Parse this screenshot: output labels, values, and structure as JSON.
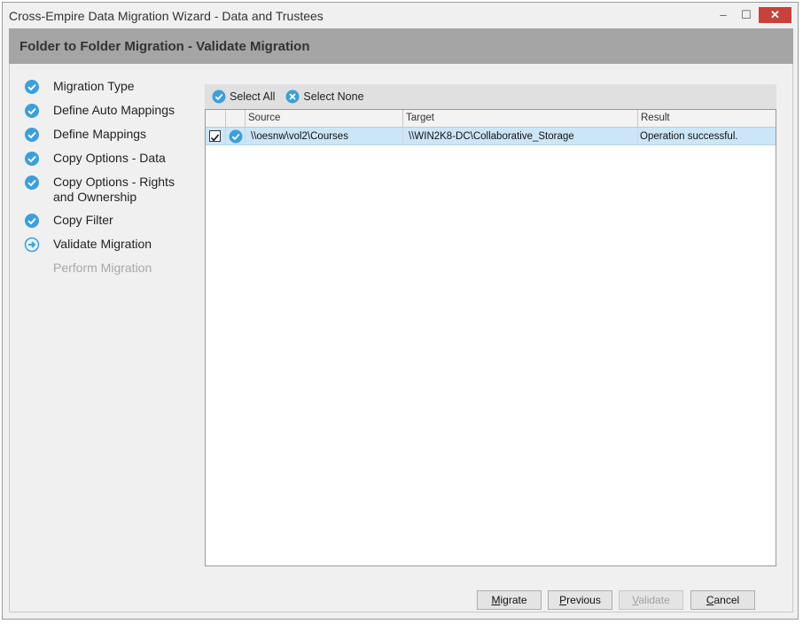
{
  "window": {
    "title": "Cross-Empire Data Migration Wizard  -  Data and Trustees",
    "min_glyph": "–",
    "max_glyph": "☐",
    "close_glyph": "✕"
  },
  "header": {
    "title": "Folder to Folder Migration  -  Validate Migration"
  },
  "steps": [
    {
      "label": "Migration Type",
      "state": "done"
    },
    {
      "label": "Define Auto Mappings",
      "state": "done"
    },
    {
      "label": "Define Mappings",
      "state": "done"
    },
    {
      "label": "Copy Options - Data",
      "state": "done"
    },
    {
      "label": "Copy Options - Rights and Ownership",
      "state": "done"
    },
    {
      "label": "Copy Filter",
      "state": "done"
    },
    {
      "label": "Validate Migration",
      "state": "current"
    },
    {
      "label": "Perform Migration",
      "state": "pending"
    }
  ],
  "toolbar": {
    "select_all": "Select All",
    "select_none": "Select None"
  },
  "grid": {
    "columns": {
      "source": "Source",
      "target": "Target",
      "result": "Result"
    },
    "rows": [
      {
        "checked": true,
        "status": "ok",
        "source": "\\\\oesnw\\vol2\\Courses",
        "target": "\\\\WIN2K8-DC\\Collaborative_Storage",
        "result": "Operation successful."
      }
    ]
  },
  "buttons": {
    "migrate": {
      "pre": "",
      "key": "M",
      "post": "igrate"
    },
    "previous": {
      "pre": "",
      "key": "P",
      "post": "revious"
    },
    "validate": {
      "pre": "",
      "key": "V",
      "post": "alidate"
    },
    "cancel": {
      "pre": "",
      "key": "C",
      "post": "ancel"
    }
  },
  "colors": {
    "accent": "#3c9fdc",
    "close": "#c8413a",
    "header_band": "#a5a5a5",
    "selected_row": "#cde6f7"
  }
}
